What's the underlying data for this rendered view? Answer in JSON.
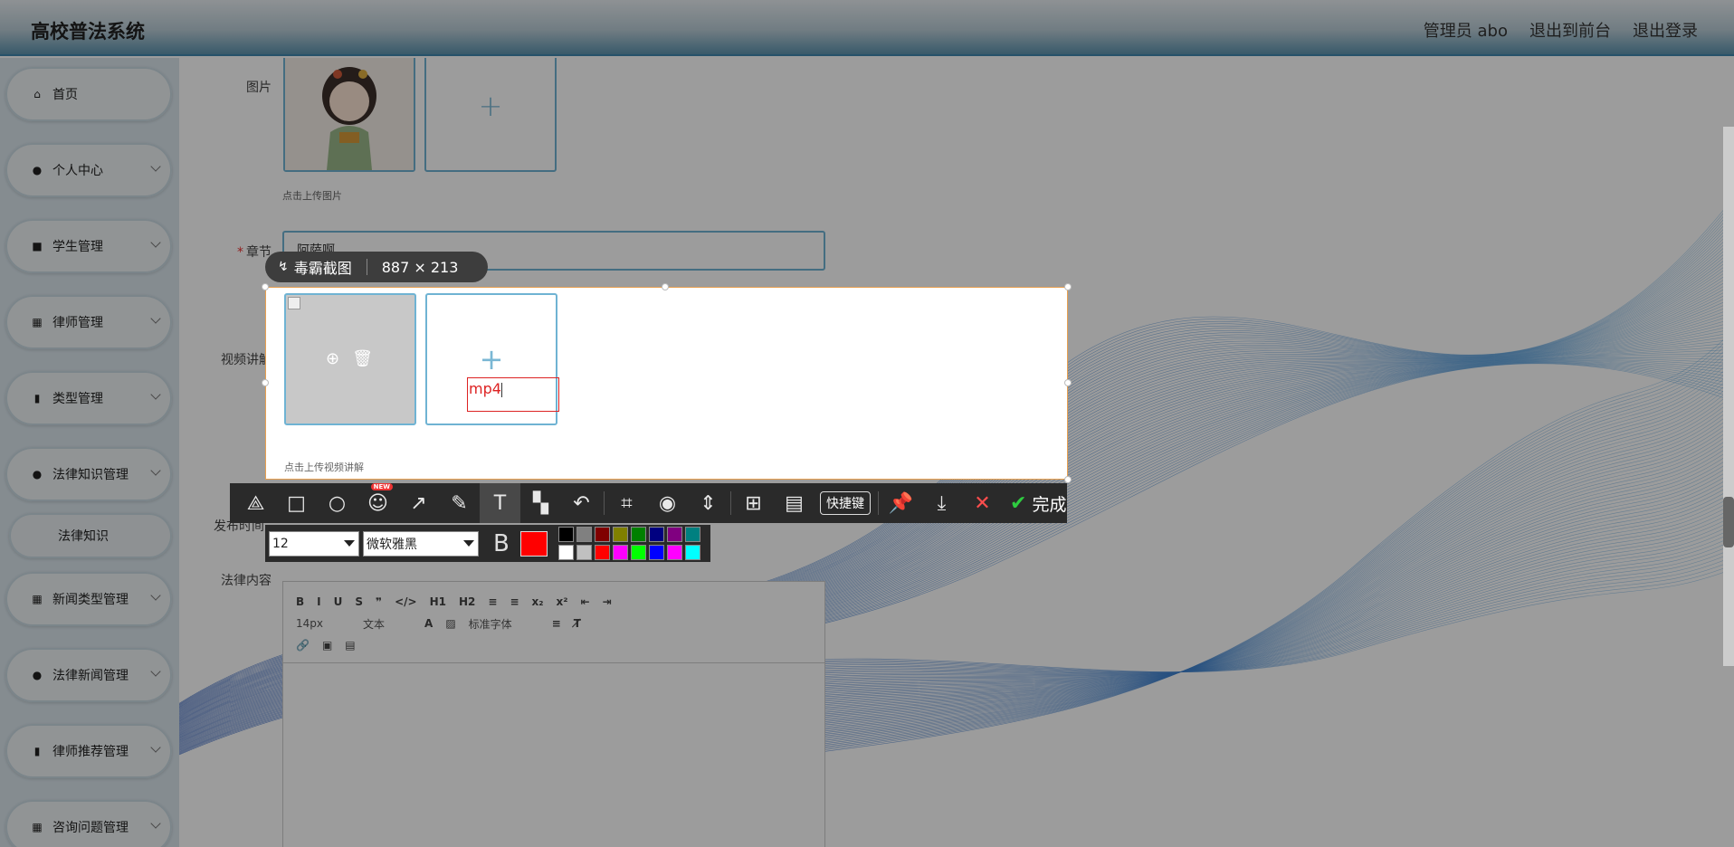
{
  "header": {
    "title": "高校普法系统",
    "admin": "管理员 abo",
    "exit_front": "退出到前台",
    "logout": "退出登录"
  },
  "sidebar": {
    "items": [
      {
        "label": "首页",
        "icon": "home-icon"
      },
      {
        "label": "个人中心",
        "icon": "user-icon"
      },
      {
        "label": "学生管理",
        "icon": "briefcase-icon"
      },
      {
        "label": "律师管理",
        "icon": "grid-icon"
      },
      {
        "label": "类型管理",
        "icon": "book-icon"
      },
      {
        "label": "法律知识管理",
        "icon": "user-icon"
      },
      {
        "label": "法律知识",
        "icon": ""
      },
      {
        "label": "新闻类型管理",
        "icon": "grid-icon"
      },
      {
        "label": "法律新闻管理",
        "icon": "user-icon"
      },
      {
        "label": "律师推荐管理",
        "icon": "book-icon"
      },
      {
        "label": "咨询问题管理",
        "icon": "grid-icon"
      }
    ]
  },
  "form": {
    "image_label": "图片",
    "image_tip": "点击上传图片",
    "chapter_label": "章节",
    "chapter_value": "阿萨啊",
    "video_label": "视频讲解",
    "video_tip": "点击上传视频讲解",
    "publish_label": "发布时间",
    "content_label": "法律内容",
    "editor": {
      "row1": [
        "B",
        "I",
        "U",
        "S",
        "❞",
        "</>",
        "H1",
        "H2",
        "≡",
        "≡",
        "x₂",
        "x²",
        "⇤",
        "⇥"
      ],
      "size": "14px",
      "text": "文本",
      "font": "标准字体"
    }
  },
  "screenshot_tool": {
    "brand": "毒霸截图",
    "dimensions": "887 × 213",
    "text_annotation": "mp4",
    "new_badge": "NEW",
    "shortcut_label": "快捷键",
    "done_label": "完成",
    "font_size": "12",
    "font_name": "微软雅黑",
    "bold_label": "B",
    "current_color": "#ff0000",
    "palette": [
      "#000000",
      "#808080",
      "#800000",
      "#808000",
      "#008000",
      "#000080",
      "#800080",
      "#008080",
      "#ffffff",
      "#c0c0c0",
      "#ff0000",
      "#ff00ff",
      "#00ff00",
      "#0000ff",
      "#ff00ff",
      "#00ffff"
    ]
  },
  "colors": {
    "accent": "#3f87ad",
    "upload_border": "#6fb3d3"
  }
}
